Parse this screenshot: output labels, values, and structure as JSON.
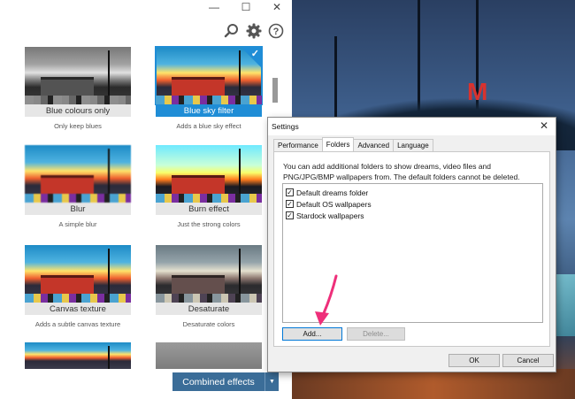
{
  "window": {
    "minimize_glyph": "—",
    "maximize_glyph": "☐",
    "close_glyph": "✕"
  },
  "toolbar": {
    "icons": [
      "search-icon",
      "gear-icon",
      "help-icon"
    ]
  },
  "effects": [
    {
      "label": "Blue colours only",
      "description": "Only keep blues",
      "selected": false
    },
    {
      "label": "Blue sky filter",
      "description": "Adds a blue sky effect",
      "selected": true
    },
    {
      "label": "Blur",
      "description": "A simple blur",
      "selected": false
    },
    {
      "label": "Burn effect",
      "description": "Just the strong colors",
      "selected": false
    },
    {
      "label": "Canvas texture",
      "description": "Adds a subtle canvas texture",
      "selected": false
    },
    {
      "label": "Desaturate",
      "description": "Desaturate colors",
      "selected": false
    }
  ],
  "combined_effects": {
    "label": "Combined effects",
    "arrow": "▼"
  },
  "wallpaper": {
    "sign_letter": "M"
  },
  "dialog": {
    "title": "Settings",
    "close_glyph": "✕",
    "tabs": [
      {
        "label": "Performance",
        "active": false
      },
      {
        "label": "Folders",
        "active": true
      },
      {
        "label": "Advanced",
        "active": false
      },
      {
        "label": "Language",
        "active": false
      }
    ],
    "intro": "You can add additional folders to show dreams, video files and PNG/JPG/BMP wallpapers from.  The default folders cannot be deleted.",
    "folders": [
      {
        "label": "Default dreams folder",
        "checked": true
      },
      {
        "label": "Default OS wallpapers",
        "checked": true
      },
      {
        "label": "Stardock wallpapers",
        "checked": true
      }
    ],
    "add_button": "Add...",
    "delete_button": "Delete...",
    "ok_button": "OK",
    "cancel_button": "Cancel",
    "check_glyph": "✓"
  },
  "colors": {
    "accent": "#1f8dd6",
    "combined_button": "#3b6d98",
    "annotation_arrow": "#ee2f7a"
  }
}
